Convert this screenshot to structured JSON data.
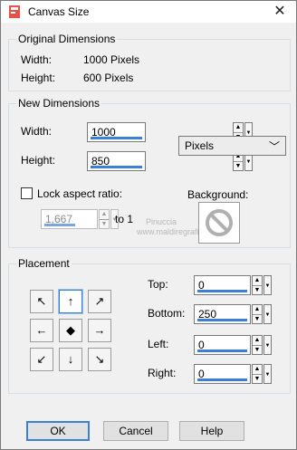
{
  "window": {
    "title": "Canvas Size"
  },
  "original": {
    "group_label": "Original Dimensions",
    "width_label": "Width:",
    "width_value": "1000 Pixels",
    "height_label": "Height:",
    "height_value": "600 Pixels"
  },
  "new_dims": {
    "group_label": "New Dimensions",
    "width_label": "Width:",
    "width_value": "1000",
    "height_label": "Height:",
    "height_value": "850",
    "units": "Pixels",
    "lock_label": "Lock aspect ratio:",
    "ratio_value": "1,667",
    "ratio_suffix": "to 1",
    "background_label": "Background:"
  },
  "placement": {
    "group_label": "Placement",
    "top_label": "Top:",
    "top_value": "0",
    "bottom_label": "Bottom:",
    "bottom_value": "250",
    "left_label": "Left:",
    "left_value": "0",
    "right_label": "Right:",
    "right_value": "0"
  },
  "watermark": {
    "line1": "Pinuccia",
    "line2": "www.maldiregrafica.eu"
  },
  "buttons": {
    "ok": "OK",
    "cancel": "Cancel",
    "help": "Help"
  },
  "colors": {
    "accent": "#3b7fd6",
    "group_border": "#d5dfe5",
    "background": "#f0f0f0"
  },
  "icons": {
    "placement_grid": [
      "arrow-up-left-icon",
      "arrow-up-icon",
      "arrow-up-right-icon",
      "arrow-left-icon",
      "center-dot-icon",
      "arrow-right-icon",
      "arrow-down-left-icon",
      "arrow-down-icon",
      "arrow-down-right-icon"
    ],
    "background_swatch": "no-color-icon"
  }
}
